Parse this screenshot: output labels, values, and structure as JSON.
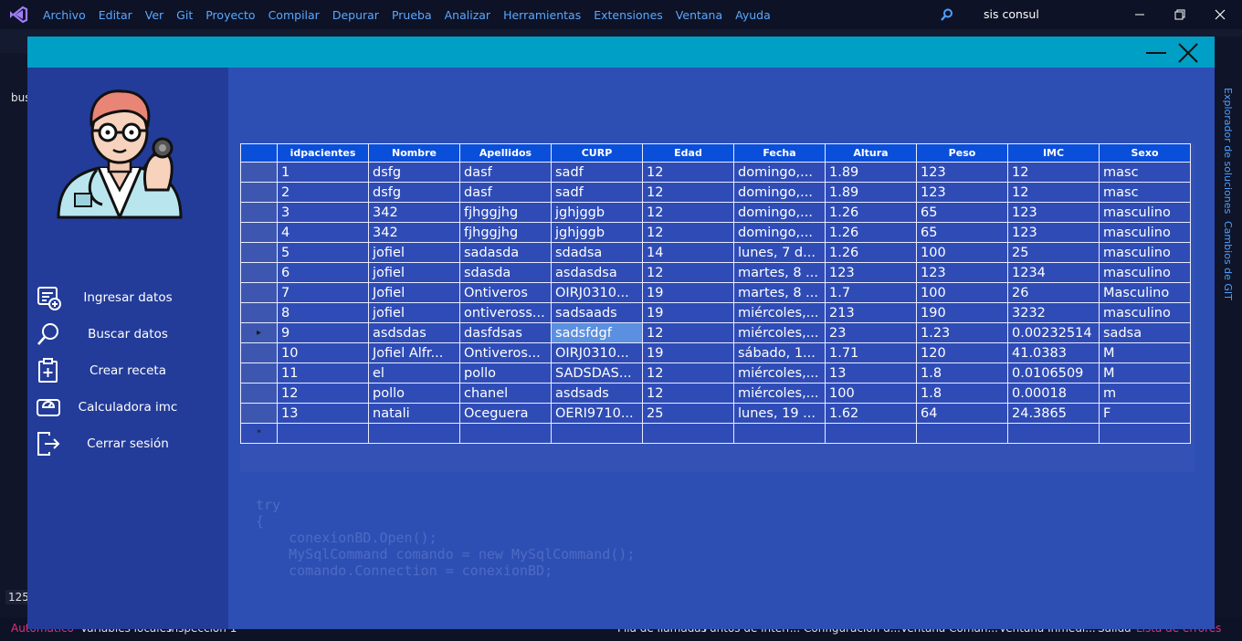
{
  "vs": {
    "menu": [
      "Archivo",
      "Editar",
      "Ver",
      "Git",
      "Proyecto",
      "Compilar",
      "Depurar",
      "Prueba",
      "Analizar",
      "Herramientas",
      "Extensiones",
      "Ventana",
      "Ayuda"
    ],
    "solution_name": "sis consul",
    "left_tab": "bus",
    "right_panels": [
      "Explorador de soluciones",
      "Cambios de GIT"
    ],
    "zoom": "125",
    "bottom_tabs": [
      "Automático",
      "Variables locales",
      "Inspección 1",
      "Pila de llamadas",
      "Puntos de interr...",
      "Configuración d...",
      "Ventana Coman...",
      "Ventana Inmedi...",
      "Salida",
      "Lista de errores"
    ]
  },
  "form": {
    "sidebar": {
      "items": [
        {
          "label": "Ingresar datos",
          "icon": "add-list-icon"
        },
        {
          "label": "Buscar datos",
          "icon": "search-icon"
        },
        {
          "label": "Crear receta",
          "icon": "clipboard-plus-icon"
        },
        {
          "label": "Calculadora imc",
          "icon": "scale-icon"
        },
        {
          "label": "Cerrar sesión",
          "icon": "logout-icon"
        }
      ]
    },
    "grid": {
      "columns": [
        "idpacientes",
        "Nombre",
        "Apellidos",
        "CURP",
        "Edad",
        "Fecha",
        "Altura",
        "Peso",
        "IMC",
        "Sexo"
      ],
      "rows": [
        [
          "1",
          "dsfg",
          "dasf",
          "sadf",
          "12",
          "domingo,...",
          "1.89",
          "123",
          "12",
          "masc"
        ],
        [
          "2",
          "dsfg",
          "dasf",
          "sadf",
          "12",
          "domingo,...",
          "1.89",
          "123",
          "12",
          "masc"
        ],
        [
          "3",
          "342",
          "fjhggjhg",
          "jghjggb",
          "12",
          "domingo,...",
          "1.26",
          "65",
          "123",
          "masculino"
        ],
        [
          "4",
          "342",
          "fjhggjhg",
          "jghjggb",
          "12",
          "domingo,...",
          "1.26",
          "65",
          "123",
          "masculino"
        ],
        [
          "5",
          "jofiel",
          "sadasda",
          "sdadsa",
          "14",
          "lunes, 7 d...",
          "1.26",
          "100",
          "25",
          "masculino"
        ],
        [
          "6",
          "jofiel",
          "sdasda",
          "asdasdsa",
          "12",
          "martes, 8 ...",
          "123",
          "123",
          "1234",
          "masculino"
        ],
        [
          "7",
          "Jofiel",
          "Ontiveros",
          "OIRJ0310...",
          "19",
          "martes, 8 ...",
          "1.7",
          "100",
          "26",
          "Masculino"
        ],
        [
          "8",
          "jofiel",
          "ontiveross...",
          "sadsaads",
          "19",
          "miércoles,...",
          "213",
          "190",
          "3232",
          "masculino"
        ],
        [
          "9",
          "asdsdas",
          "dasfdsas",
          "sadsfdgf",
          "12",
          "miércoles,...",
          "23",
          "1.23",
          "0.00232514",
          "sadsa"
        ],
        [
          "10",
          "Jofiel Alfr...",
          "Ontiveros...",
          "OIRJ0310...",
          "19",
          "sábado, 1...",
          "1.71",
          "120",
          "41.0383",
          "M"
        ],
        [
          "11",
          "el",
          "pollo",
          "SADSDAS...",
          "12",
          "miércoles,...",
          "13",
          "1.8",
          "0.0106509",
          "M"
        ],
        [
          "12",
          "pollo",
          "chanel",
          "asdsads",
          "12",
          "miércoles,...",
          "100",
          "1.8",
          "0.00018",
          "m"
        ],
        [
          "13",
          "natali",
          "Oceguera",
          "OERI9710...",
          "25",
          "lunes, 19 ...",
          "1.62",
          "64",
          "24.3865",
          "F"
        ]
      ],
      "current_row_index": 8,
      "selected_column": "CURP",
      "new_row_marker": "*",
      "current_row_marker": "▸"
    }
  },
  "colors": {
    "titlebar": "#009fc6",
    "sidebar": "#233c99",
    "main": "#2d4fb4",
    "header": "#0a4fd9",
    "selection": "#5b8fe0"
  }
}
